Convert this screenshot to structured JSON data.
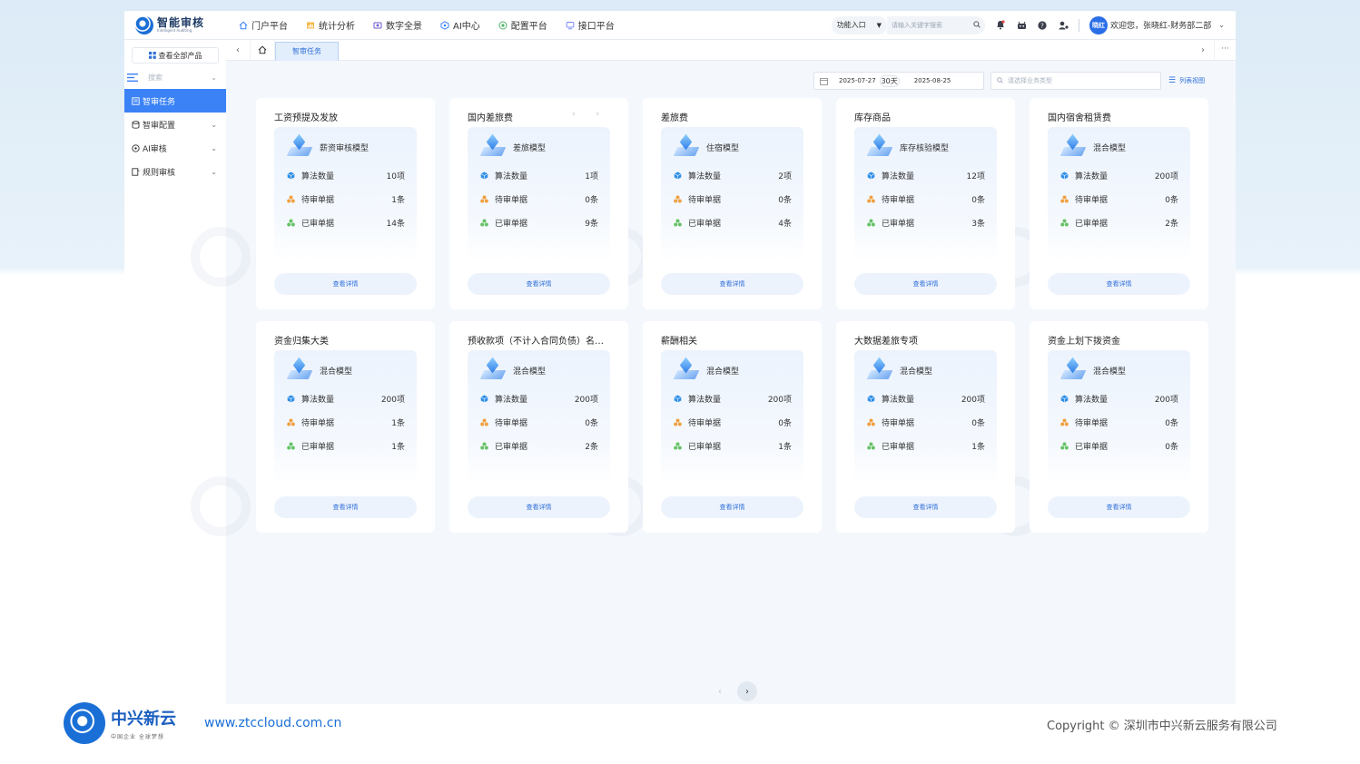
{
  "app": {
    "logo_cn": "智能审核",
    "logo_en": "Intelligent Auditing"
  },
  "topnav": {
    "items": [
      {
        "label": "门户平台",
        "icon": "home-icon"
      },
      {
        "label": "统计分析",
        "icon": "chart-icon"
      },
      {
        "label": "数字全景",
        "icon": "panorama-icon"
      },
      {
        "label": "AI中心",
        "icon": "ai-icon"
      },
      {
        "label": "配置平台",
        "icon": "config-icon"
      },
      {
        "label": "接口平台",
        "icon": "interface-icon"
      }
    ],
    "func_entry": "功能入口",
    "search_placeholder": "请输入关键字搜索",
    "avatar_text": "晓红",
    "welcome": "欢迎您，张晓红-财务部二部"
  },
  "sidebar": {
    "all_products": "查看全部产品",
    "search_placeholder": "搜索",
    "items": [
      {
        "label": "智审任务",
        "active": true,
        "has_children": false
      },
      {
        "label": "智审配置",
        "active": false,
        "has_children": true
      },
      {
        "label": "AI审核",
        "active": false,
        "has_children": true
      },
      {
        "label": "规则审核",
        "active": false,
        "has_children": true
      }
    ]
  },
  "tabbar": {
    "active_tab": "智审任务"
  },
  "filters": {
    "date_start": "2025-07-27",
    "date_days": "30天",
    "date_end": "2025-08-25",
    "type_placeholder": "请选择业务类型",
    "list_view": "列表视图"
  },
  "stat_labels": {
    "algo": "算法数量",
    "pending": "待审单据",
    "done": "已审单据"
  },
  "detail_label": "查看详情",
  "cards": [
    {
      "title": "工资预提及发放",
      "model": "薪资审核模型",
      "algo": "10项",
      "pending": "1条",
      "done": "14条"
    },
    {
      "title": "国内差旅费",
      "model": "差旅模型",
      "algo": "1项",
      "pending": "0条",
      "done": "9条",
      "pager": "‹ ›"
    },
    {
      "title": "差旅费",
      "model": "住宿模型",
      "algo": "2项",
      "pending": "0条",
      "done": "4条"
    },
    {
      "title": "库存商品",
      "model": "库存核验模型",
      "algo": "12项",
      "pending": "0条",
      "done": "3条"
    },
    {
      "title": "国内宿舍租赁费",
      "model": "混合模型",
      "algo": "200项",
      "pending": "0条",
      "done": "2条"
    },
    {
      "title": "资金归集大类",
      "model": "混合模型",
      "algo": "200项",
      "pending": "1条",
      "done": "1条"
    },
    {
      "title": "预收款项（不计入合同负债）名下款项",
      "model": "混合模型",
      "algo": "200项",
      "pending": "0条",
      "done": "2条"
    },
    {
      "title": "薪酬相关",
      "model": "混合模型",
      "algo": "200项",
      "pending": "0条",
      "done": "1条"
    },
    {
      "title": "大数据差旅专项",
      "model": "混合模型",
      "algo": "200项",
      "pending": "0条",
      "done": "1条"
    },
    {
      "title": "资金上划下拨资金",
      "model": "混合模型",
      "algo": "200项",
      "pending": "0条",
      "done": "0条"
    }
  ],
  "watermark": "中兴新云",
  "footer": {
    "brand": "中兴新云",
    "slogan": "中国企业 全球梦想",
    "url": "www.ztccloud.com.cn",
    "copyright": "Copyright © 深圳市中兴新云服务有限公司"
  },
  "colors": {
    "accent": "#3b82f6",
    "brand": "#1a6fd6",
    "algo_icon": "#2f8fe8",
    "pending_icon": "#f0a040",
    "done_icon": "#66c266"
  }
}
